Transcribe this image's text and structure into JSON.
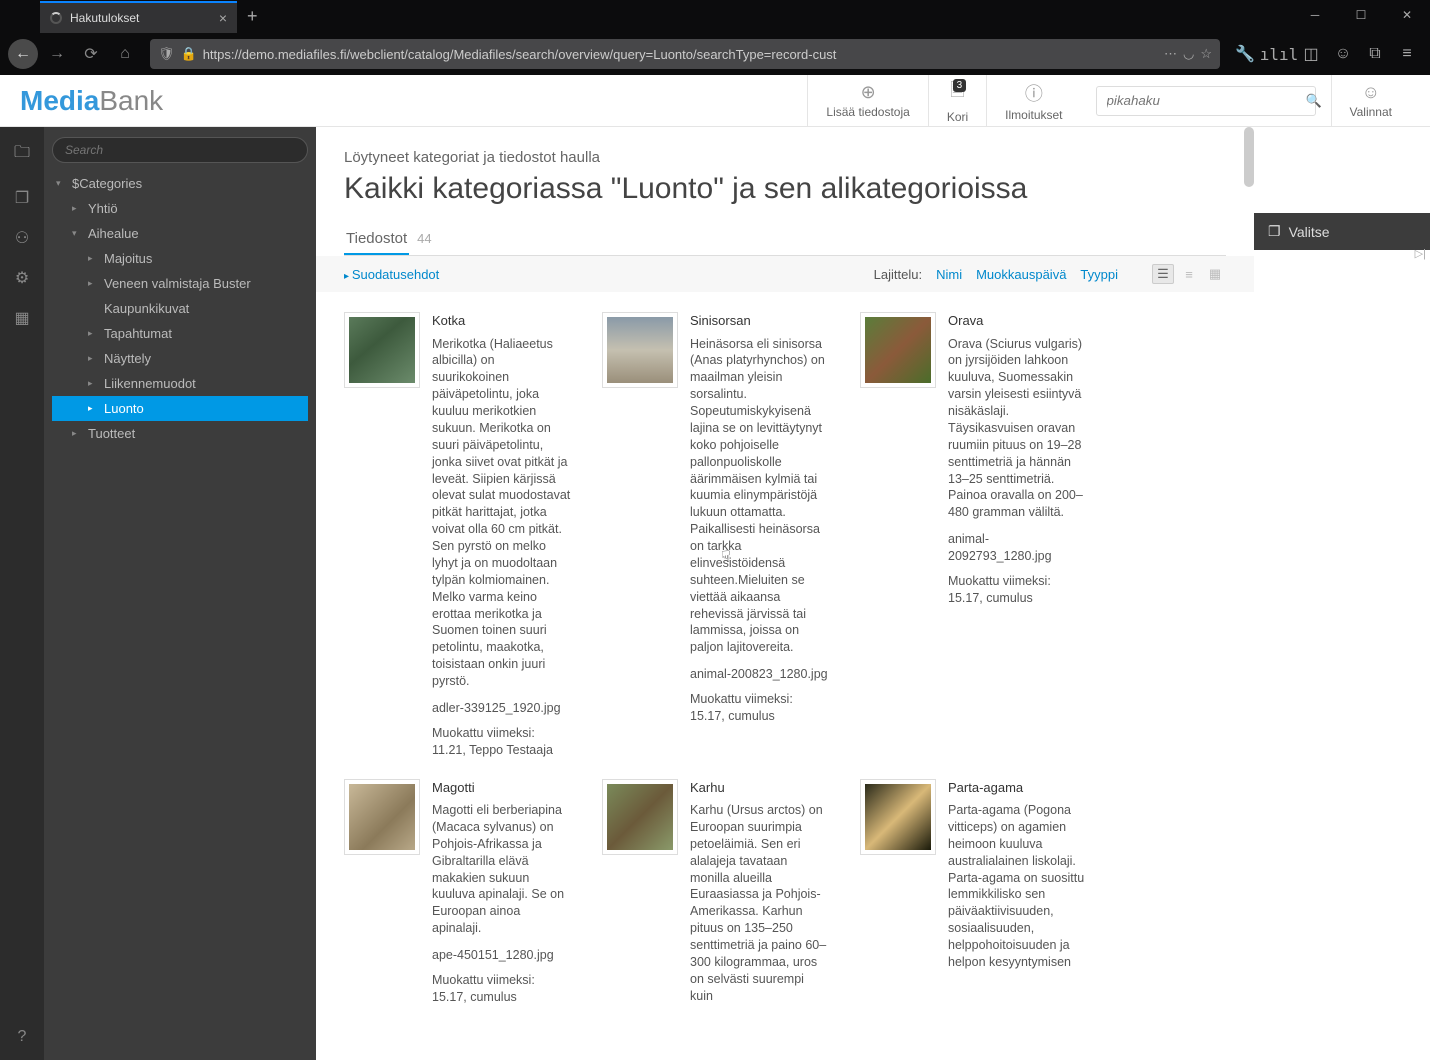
{
  "browser": {
    "tab_title": "Hakutulokset",
    "url": "https://demo.mediafiles.fi/webclient/catalog/Mediafiles/search/overview/query=Luonto/searchType=record-cust"
  },
  "logo": {
    "part1": "Media",
    "part2": "Bank"
  },
  "header": {
    "add_files": "Lisää tiedostoja",
    "cart": "Kori",
    "cart_badge": "3",
    "notifications": "Ilmoitukset",
    "quicksearch_placeholder": "pikahaku",
    "selections": "Valinnat"
  },
  "sidebar": {
    "search_placeholder": "Search",
    "root": "$Categories",
    "items": {
      "company": "Yhtiö",
      "topic": "Aihealue",
      "accommodation": "Majoitus",
      "boat": "Veneen valmistaja Buster",
      "cityphotos": "Kaupunkikuvat",
      "events": "Tapahtumat",
      "exhibition": "Näyttely",
      "transport": "Liikennemuodot",
      "nature": "Luonto",
      "products": "Tuotteet"
    }
  },
  "content": {
    "subtitle": "Löytyneet kategoriat ja tiedostot haulla",
    "title": "Kaikki kategoriassa \"Luonto\" ja sen alikategorioissa",
    "tab": "Tiedostot",
    "count": "44",
    "filter": "Suodatusehdot",
    "sort_label": "Lajittelu:",
    "sort_name": "Nimi",
    "sort_modified": "Muokkauspäivä",
    "sort_type": "Tyyppi"
  },
  "records": [
    {
      "title": "Kotka",
      "desc": "Merikotka (Haliaeetus albicilla) on suurikokoinen päiväpetolintu, joka kuuluu merikotkien sukuun. Merikotka on suuri päiväpetolintu, jonka siivet ovat pitkät ja leveät. Siipien kärjissä olevat sulat muodostavat pitkät harittajat, jotka voivat olla 60 cm pitkät. Sen pyrstö on melko lyhyt ja on muodoltaan tylpän kolmiomainen. Melko varma keino erottaa merikotka ja Suomen toinen suuri petolintu, maakotka, toisistaan onkin juuri pyrstö.",
      "file": "adler-339125_1920.jpg",
      "modified": "Muokattu viimeksi: 11.21, Teppo Testaaja",
      "thumb": "linear-gradient(140deg,#5a7a5a 0%,#3d5a3d 40%,#6b8b6b 100%)"
    },
    {
      "title": "Sinisorsan",
      "desc": "Heinäsorsa eli sinisorsa (Anas platyrhynchos) on maailman yleisin sorsalintu. Sopeutumiskykyisenä lajina se on levittäytynyt koko pohjoiselle pallonpuoliskolle äärimmäisen kylmiä tai kuumia elinympäristöjä lukuun ottamatta. Paikallisesti heinäsorsa on tarkka elinvesistöidensä suhteen.Mieluiten se viettää aikaansa rehevissä järvissä tai lammissa, joissa on paljon lajitovereita.",
      "file": "animal-200823_1280.jpg",
      "modified": "Muokattu viimeksi: 15.17, cumulus",
      "thumb": "linear-gradient(180deg,#8a9aa8 0%,#c5c0b0 50%,#9a8f7a 100%)"
    },
    {
      "title": "Orava",
      "desc": "Orava (Sciurus vulgaris) on jyrsijöiden lahkoon kuuluva, Suomessakin varsin yleisesti esiintyvä nisäkäslaji. Täysikasvuisen oravan ruumiin pituus on 19–28 senttimetriä ja hännän 13–25 senttimetriä. Painoa oravalla on 200–480 gramman väliltä.",
      "file": "animal-2092793_1280.jpg",
      "modified": "Muokattu viimeksi: 15.17, cumulus",
      "thumb": "linear-gradient(135deg,#5a7d3a 0%,#8b5a3a 50%,#4a6d2a 100%)"
    },
    {
      "title": "Magotti",
      "desc": "Magotti eli berberiapina (Macaca sylvanus) on Pohjois-Afrikassa ja Gibraltarilla elävä makakien sukuun kuuluva apinalaji. Se on Euroopan ainoa apinalaji.",
      "file": "ape-450151_1280.jpg",
      "modified": "Muokattu viimeksi: 15.17, cumulus",
      "thumb": "linear-gradient(135deg,#c8b898 0%,#8b7a5a 60%,#b8a888 100%)"
    },
    {
      "title": "Karhu",
      "desc": "Karhu (Ursus arctos) on Euroopan suurimpia petoeläimiä. Sen eri alalajeja tavataan monilla alueilla Euraasiassa ja Pohjois-Amerikassa. Karhun pituus on 135–250 senttimetriä ja paino 60–300 kilogrammaa, uros on selvästi suurempi kuin",
      "file": "",
      "modified": "",
      "thumb": "linear-gradient(135deg,#7a8a5a 0%,#6b5a3a 50%,#8a9a6a 100%)"
    },
    {
      "title": "Parta-agama",
      "desc": "Parta-agama (Pogona vitticeps) on agamien heimoon kuuluva australialainen liskolaji. Parta-agama on suosittu lemmikkilisko sen päiväaktiivisuuden, sosiaalisuuden, helppohoitoisuuden ja helpon kesyyntymisen",
      "file": "",
      "modified": "",
      "thumb": "linear-gradient(135deg,#2a2a1a 0%,#d8b878 50%,#1a1a0a 100%)"
    }
  ],
  "right_rail": {
    "select": "Valitse"
  }
}
